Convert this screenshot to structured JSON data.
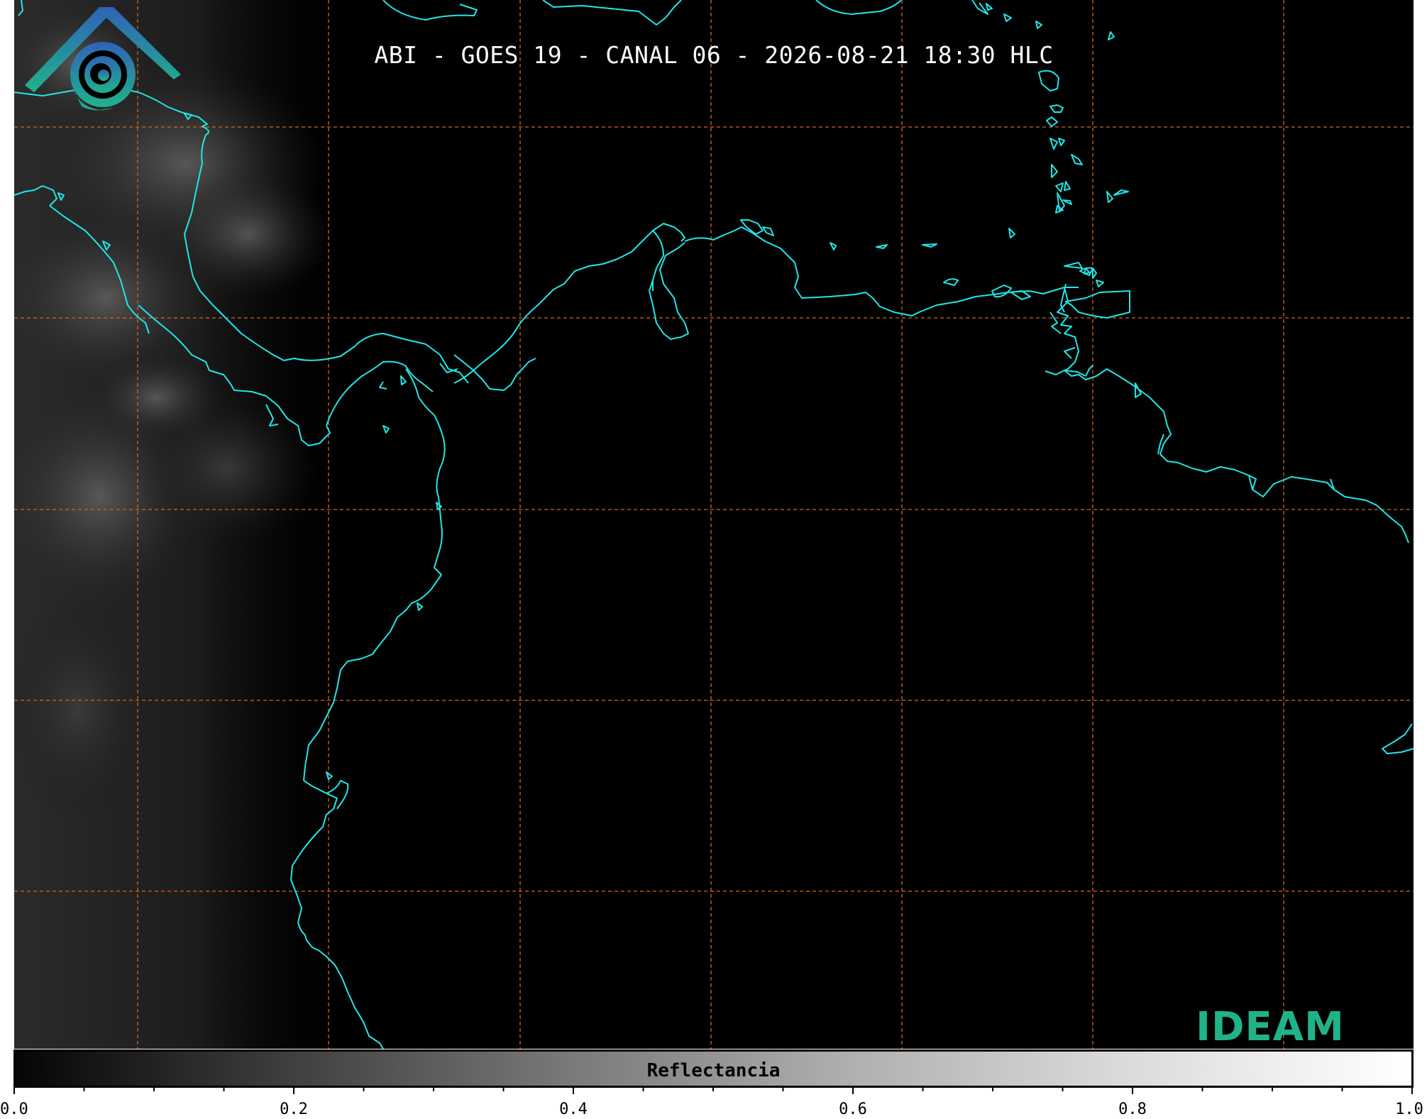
{
  "title": "ABI - GOES 19 - CANAL 06 - 2026-08-21 18:30 HLC",
  "logo": {
    "text": "IDEAM",
    "brand_color": "#20b38a",
    "gradient_top": "#2f63b8"
  },
  "colorbar": {
    "label": "Reflectancia",
    "tick_labels": [
      "0.0",
      "0.2",
      "0.4",
      "0.6",
      "0.8",
      "1.0"
    ],
    "range": [
      0.0,
      1.0
    ],
    "colormap": "grayscale"
  },
  "map": {
    "coastline_color": "#21e6e6",
    "grid_color": "#d9651f",
    "background": "#000000"
  }
}
